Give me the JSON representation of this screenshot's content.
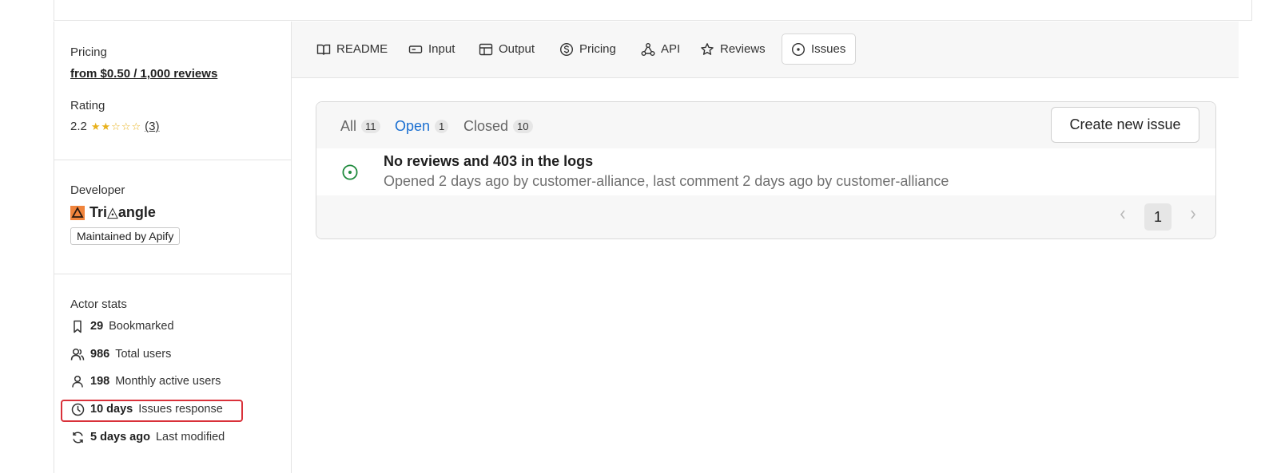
{
  "sidebar": {
    "pricing_label": "Pricing",
    "pricing_value": "from $0.50 / 1,000 reviews",
    "rating_label": "Rating",
    "rating_value": "2.2",
    "rating_stars": 2.2,
    "rating_count": "(3)",
    "developer_label": "Developer",
    "developer_name": "Tri◬angle",
    "maintained_badge": "Maintained by Apify",
    "stats_label": "Actor stats",
    "stats": [
      {
        "value": "29",
        "label": "Bookmarked",
        "icon": "bookmark-icon"
      },
      {
        "value": "986",
        "label": "Total users",
        "icon": "users-icon"
      },
      {
        "value": "198",
        "label": "Monthly active users",
        "icon": "user-icon"
      },
      {
        "value": "10 days",
        "label": "Issues response",
        "icon": "clock-icon"
      },
      {
        "value": "5 days ago",
        "label": "Last modified",
        "icon": "refresh-icon"
      }
    ]
  },
  "tabs": [
    {
      "label": "README",
      "icon": "book-icon"
    },
    {
      "label": "Input",
      "icon": "input-icon"
    },
    {
      "label": "Output",
      "icon": "table-icon"
    },
    {
      "label": "Pricing",
      "icon": "dollar-icon"
    },
    {
      "label": "API",
      "icon": "api-icon"
    },
    {
      "label": "Reviews",
      "icon": "star-icon"
    },
    {
      "label": "Issues",
      "icon": "issue-icon",
      "active": true
    }
  ],
  "issues": {
    "filters": [
      {
        "label": "All",
        "count": "11"
      },
      {
        "label": "Open",
        "count": "1",
        "active": true
      },
      {
        "label": "Closed",
        "count": "10"
      }
    ],
    "create_button": "Create new issue",
    "items": [
      {
        "title": "No reviews and 403 in the logs",
        "meta": "Opened 2 days ago by customer-alliance, last comment 2 days ago by customer-alliance",
        "status": "open"
      }
    ],
    "pagination": {
      "current": "1"
    }
  },
  "colors": {
    "accent": "#1a6fd1",
    "open_status": "#1f8a3d",
    "highlight": "#d9313a",
    "star": "#e8b11c"
  }
}
